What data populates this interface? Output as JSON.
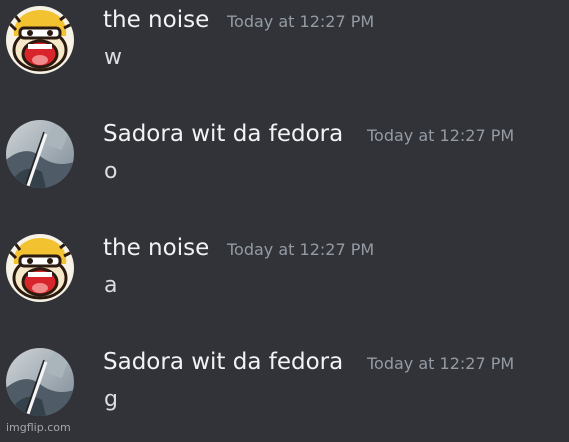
{
  "messages": [
    {
      "username": "the noise",
      "timestamp": "Today at 12:27 PM",
      "content": "w",
      "avatar_icon": "noise-face-avatar-icon"
    },
    {
      "username": "Sadora wit da fedora",
      "timestamp": "Today at 12:27 PM",
      "content": "o",
      "avatar_icon": "sadora-avatar-icon"
    },
    {
      "username": "the noise",
      "timestamp": "Today at 12:27 PM",
      "content": "a",
      "avatar_icon": "noise-face-avatar-icon"
    },
    {
      "username": "Sadora wit da fedora",
      "timestamp": "Today at 12:27 PM",
      "content": "g",
      "avatar_icon": "sadora-avatar-icon"
    }
  ],
  "watermark": "imgflip.com",
  "colors": {
    "background": "#313338",
    "username": "#f2f3f5",
    "timestamp": "#949ba4",
    "message_text": "#dbdee1"
  }
}
